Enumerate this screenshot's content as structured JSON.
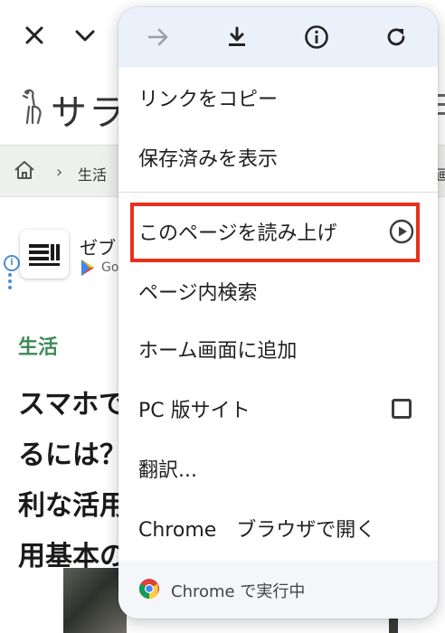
{
  "background": {
    "site_logo_text": "サラ",
    "breadcrumb": {
      "separator": "›",
      "label": "生活",
      "right_text": "画"
    },
    "ad": {
      "title": "ゼブ",
      "subtitle": "Go"
    },
    "category": "生活",
    "article_title_lines": [
      "スマホで",
      "るには？",
      "利な活用",
      "用基本の"
    ]
  },
  "menu": {
    "toolbar": {
      "forward": "forward-arrow-icon",
      "download": "download-icon",
      "info": "info-icon",
      "reload": "reload-icon"
    },
    "items": [
      {
        "label": "リンクをコピー"
      },
      {
        "label": "保存済みを表示"
      },
      {
        "label": "このページを読み上げ",
        "highlighted": true,
        "trailing": "play-circle-icon"
      },
      {
        "label": "ページ内検索"
      },
      {
        "label": "ホーム画面に追加"
      },
      {
        "label": "PC 版サイト",
        "trailing": "checkbox-unchecked",
        "checked": false
      },
      {
        "label": "翻訳..."
      },
      {
        "label": "Chrome　ブラウザで開く"
      }
    ],
    "footer": {
      "text": "Chrome で実行中"
    }
  },
  "colors": {
    "menu_toolbar_bg": "#eaf1fb",
    "highlight_border": "#e8301e",
    "category_green": "#3f8a5a",
    "ad_info_blue": "#4a8fd1"
  }
}
